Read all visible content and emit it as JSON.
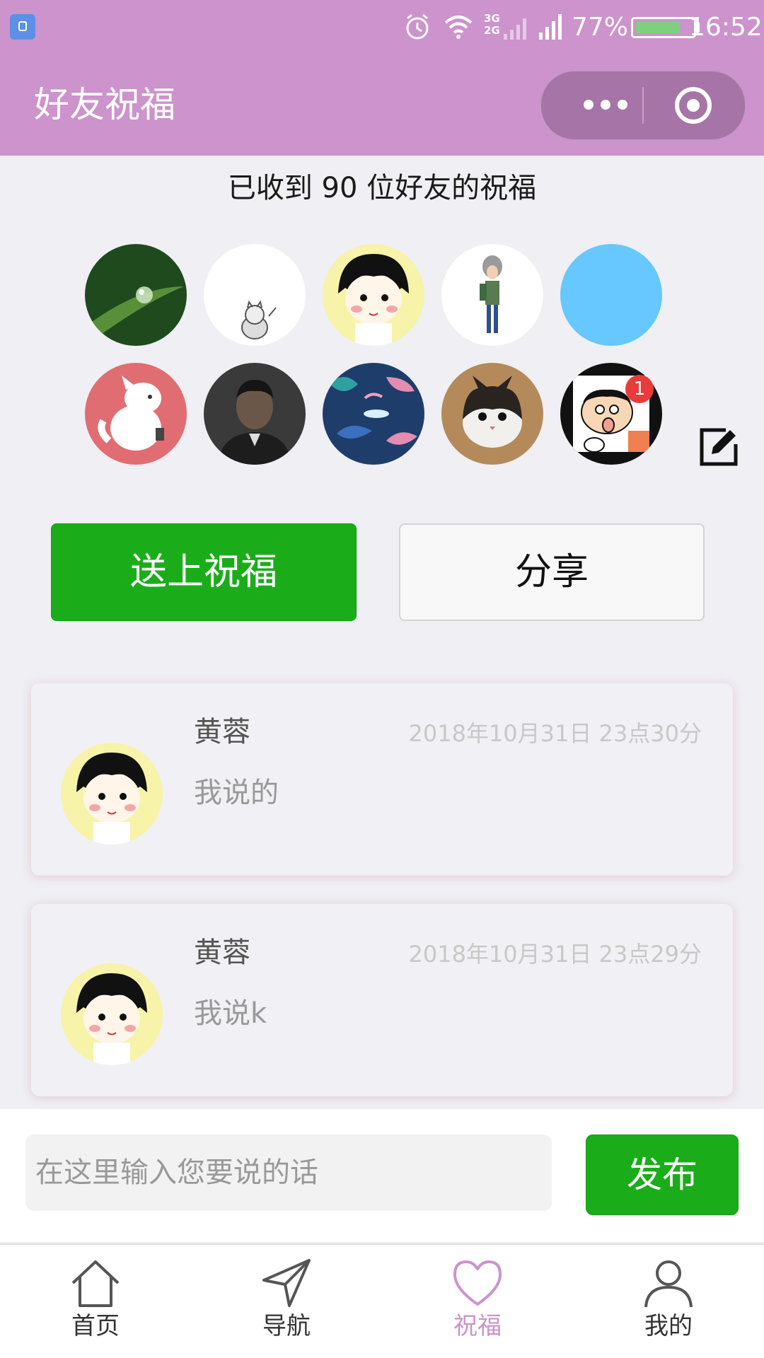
{
  "status_bar": {
    "network": "3G\n2G",
    "battery_percent": "77%",
    "battery_level": 0.77,
    "time": "16:52"
  },
  "navbar": {
    "title": "好友祝福",
    "icons": [
      "more-dots-icon",
      "close-target-icon"
    ]
  },
  "received_text": "已收到 90 位好友的祝福",
  "avatars": [
    {
      "name": "leaf-droplet",
      "colors": [
        "#1e4a1e",
        "#a8d08a"
      ]
    },
    {
      "name": "cat-sketch",
      "colors": [
        "#ffffff",
        "#777777"
      ]
    },
    {
      "name": "cartoon-girl",
      "colors": [
        "#f7f3a8",
        "#111111"
      ]
    },
    {
      "name": "illustrated-boy",
      "colors": [
        "#ffffff",
        "#5a7a52"
      ]
    },
    {
      "name": "blue-circle",
      "colors": [
        "#66c8ff",
        "#66c8ff"
      ]
    },
    {
      "name": "white-dog",
      "colors": [
        "#e06d72",
        "#ffffff"
      ]
    },
    {
      "name": "man-portrait",
      "colors": [
        "#3a3a3a",
        "#6b5748"
      ]
    },
    {
      "name": "leaf-pattern",
      "colors": [
        "#1e3d6b",
        "#e58cb0"
      ]
    },
    {
      "name": "kitten",
      "colors": [
        "#b48a5a",
        "#2a2420"
      ]
    },
    {
      "name": "crayon-boy",
      "colors": [
        "#111111",
        "#f7d7b5"
      ]
    }
  ],
  "avatar_badge": "1",
  "buttons": {
    "send_blessing": "送上祝福",
    "share": "分享"
  },
  "messages": [
    {
      "name": "黄蓉",
      "time": "2018年10月31日 23点30分",
      "text": "我说的"
    },
    {
      "name": "黄蓉",
      "time": "2018年10月31日 23点29分",
      "text": "我说k"
    }
  ],
  "composer": {
    "placeholder": "在这里输入您要说的话",
    "publish": "发布"
  },
  "tabs": [
    {
      "label": "首页",
      "icon": "home-icon"
    },
    {
      "label": "导航",
      "icon": "navigation-icon"
    },
    {
      "label": "祝福",
      "icon": "heart-icon",
      "active": true
    },
    {
      "label": "我的",
      "icon": "profile-icon"
    }
  ],
  "colors": {
    "header": "#cc93cc",
    "primary_green": "#1aad19",
    "active_tab": "#cc93cc",
    "background": "#efeff4"
  }
}
